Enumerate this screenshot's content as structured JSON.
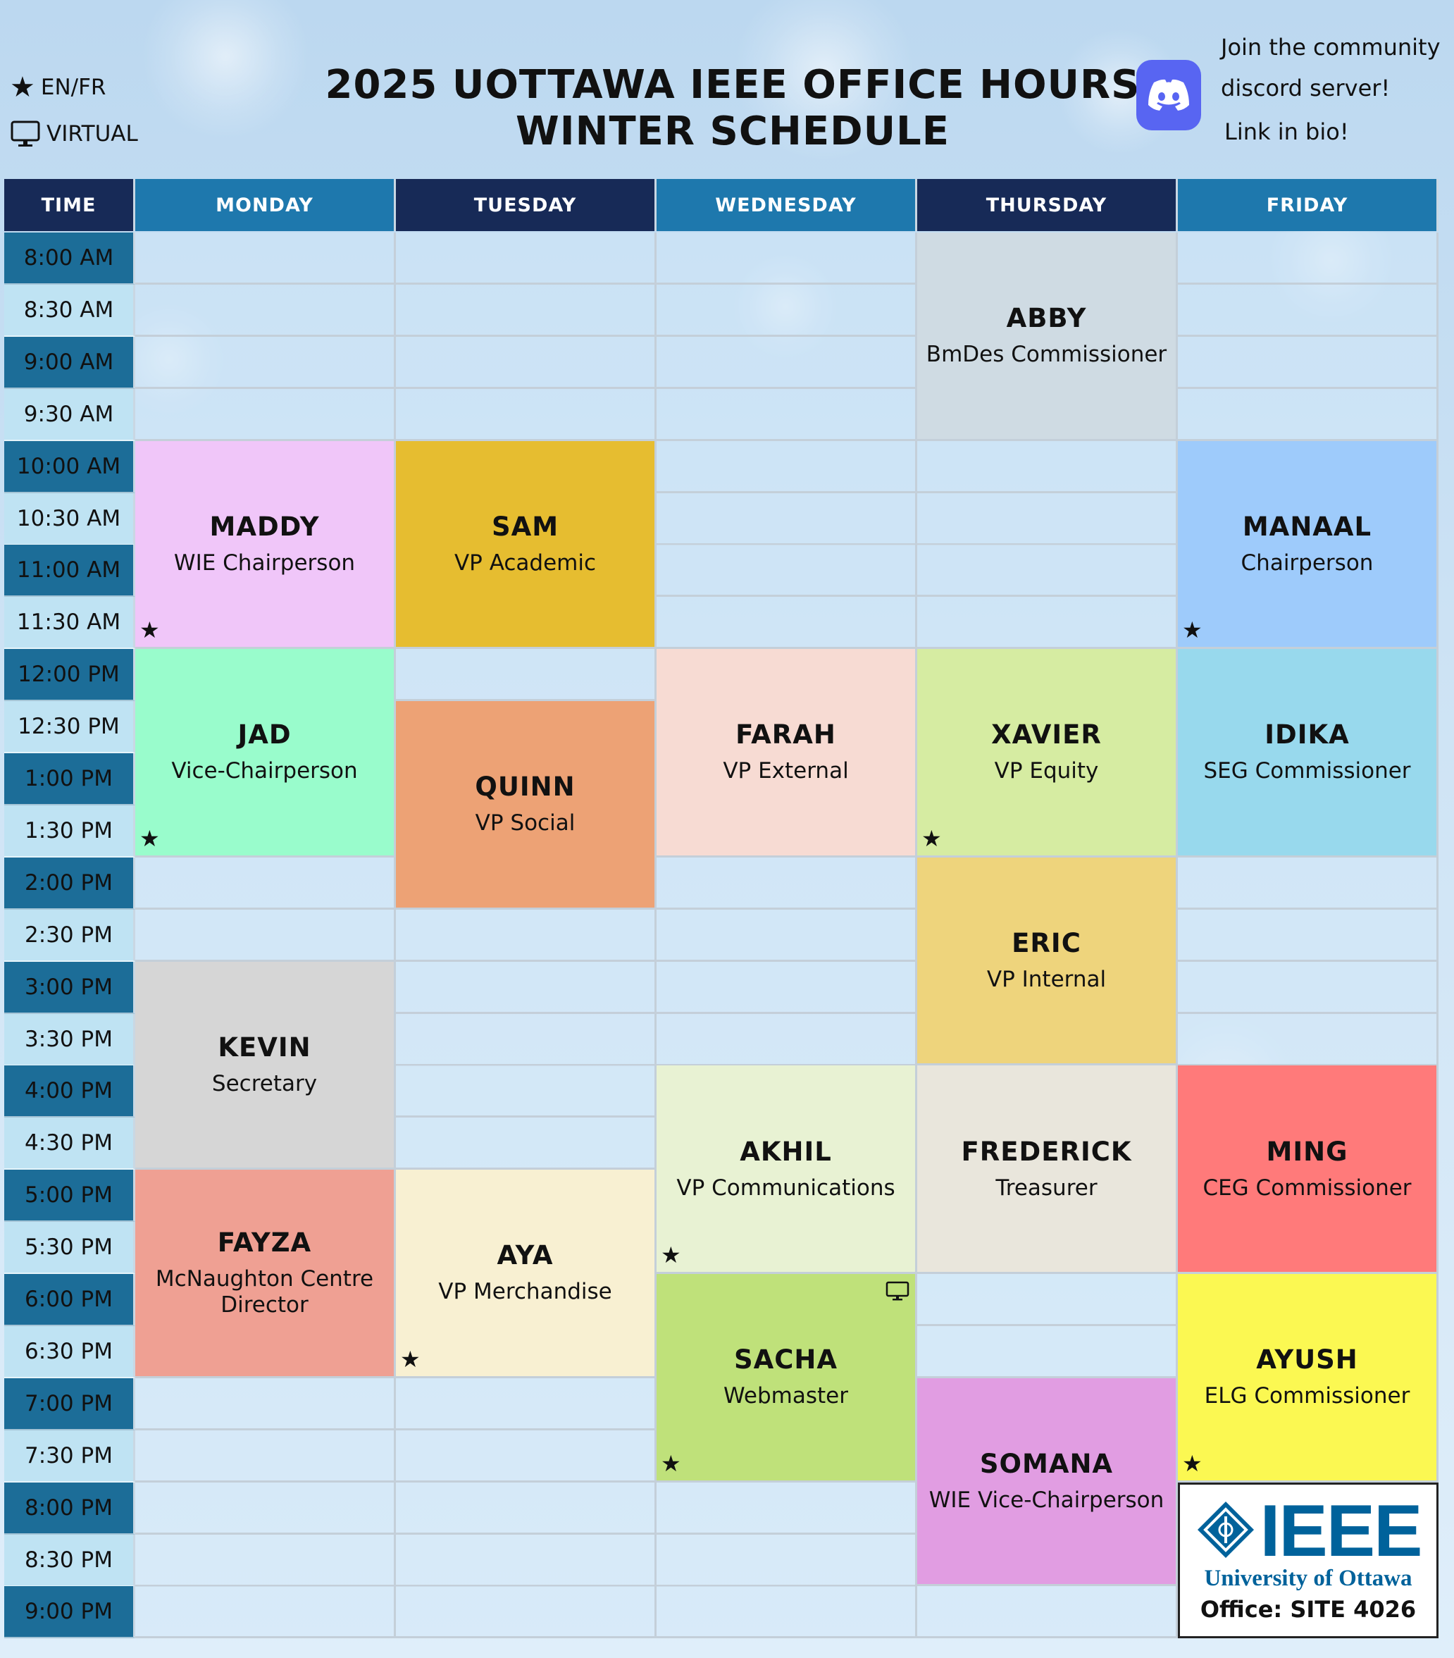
{
  "header": {
    "title_line1": "2025 UOTTAWA IEEE OFFICE HOURS",
    "title_line2": "WINTER SCHEDULE",
    "legend_bilingual": "EN/FR",
    "legend_virtual": "VIRTUAL",
    "discord_line1": "Join the community",
    "discord_line2": "discord server!",
    "discord_line3": "Link in bio!"
  },
  "columns": {
    "time": "TIME",
    "days": [
      "MONDAY",
      "TUESDAY",
      "WEDNESDAY",
      "THURSDAY",
      "FRIDAY"
    ]
  },
  "times": [
    "8:00 AM",
    "8:30 AM",
    "9:00 AM",
    "9:30 AM",
    "10:00 AM",
    "10:30 AM",
    "11:00 AM",
    "11:30 AM",
    "12:00 PM",
    "12:30 PM",
    "1:00 PM",
    "1:30 PM",
    "2:00 PM",
    "2:30 PM",
    "3:00 PM",
    "3:30 PM",
    "4:00 PM",
    "4:30 PM",
    "5:00 PM",
    "5:30 PM",
    "6:00 PM",
    "6:30 PM",
    "7:00 PM",
    "7:30 PM",
    "8:00 PM",
    "8:30 PM",
    "9:00 PM"
  ],
  "blocks": [
    {
      "name": "ABBY",
      "role": "BmDes Commissioner",
      "day": 3,
      "start": 0,
      "span": 4,
      "color": "#cfdbe3",
      "bilingual": false,
      "virtual": false
    },
    {
      "name": "MADDY",
      "role": "WIE Chairperson",
      "day": 0,
      "start": 4,
      "span": 4,
      "color": "#f0c6f9",
      "bilingual": true,
      "virtual": false
    },
    {
      "name": "SAM",
      "role": "VP Academic",
      "day": 1,
      "start": 4,
      "span": 4,
      "color": "#e6bd30",
      "bilingual": false,
      "virtual": false
    },
    {
      "name": "MANAAL",
      "role": "Chairperson",
      "day": 4,
      "start": 4,
      "span": 4,
      "color": "#9ecbfb",
      "bilingual": true,
      "virtual": false
    },
    {
      "name": "JAD",
      "role": "Vice-Chairperson",
      "day": 0,
      "start": 8,
      "span": 4,
      "color": "#99fccc",
      "bilingual": true,
      "virtual": false
    },
    {
      "name": "QUINN",
      "role": "VP Social",
      "day": 1,
      "start": 9,
      "span": 4,
      "color": "#eda275",
      "bilingual": false,
      "virtual": false
    },
    {
      "name": "FARAH",
      "role": "VP External",
      "day": 2,
      "start": 8,
      "span": 4,
      "color": "#f7dbd3",
      "bilingual": false,
      "virtual": false
    },
    {
      "name": "XAVIER",
      "role": "VP Equity",
      "day": 3,
      "start": 8,
      "span": 4,
      "color": "#d6eca2",
      "bilingual": true,
      "virtual": false
    },
    {
      "name": "IDIKA",
      "role": "SEG Commissioner",
      "day": 4,
      "start": 8,
      "span": 4,
      "color": "#98d9ed",
      "bilingual": false,
      "virtual": false
    },
    {
      "name": "ERIC",
      "role": "VP Internal",
      "day": 3,
      "start": 12,
      "span": 4,
      "color": "#eed47c",
      "bilingual": false,
      "virtual": false
    },
    {
      "name": "KEVIN",
      "role": "Secretary",
      "day": 0,
      "start": 14,
      "span": 4,
      "color": "#d6d6d6",
      "bilingual": false,
      "virtual": false
    },
    {
      "name": "AKHIL",
      "role": "VP Communications",
      "day": 2,
      "start": 16,
      "span": 4,
      "color": "#e8f2d3",
      "bilingual": true,
      "virtual": false
    },
    {
      "name": "FREDERICK",
      "role": "Treasurer",
      "day": 3,
      "start": 16,
      "span": 4,
      "color": "#e9e6dc",
      "bilingual": false,
      "virtual": false
    },
    {
      "name": "MING",
      "role": "CEG Commissioner",
      "day": 4,
      "start": 16,
      "span": 4,
      "color": "#ff7a7a",
      "bilingual": false,
      "virtual": false
    },
    {
      "name": "FAYZA",
      "role": "McNaughton Centre Director",
      "day": 0,
      "start": 18,
      "span": 4,
      "color": "#efa093",
      "bilingual": false,
      "virtual": false
    },
    {
      "name": "AYA",
      "role": "VP Merchandise",
      "day": 1,
      "start": 18,
      "span": 4,
      "color": "#f8f0d2",
      "bilingual": true,
      "virtual": false
    },
    {
      "name": "SACHA",
      "role": "Webmaster",
      "day": 2,
      "start": 20,
      "span": 4,
      "color": "#bfe17a",
      "bilingual": true,
      "virtual": true
    },
    {
      "name": "AYUSH",
      "role": "ELG Commissioner",
      "day": 4,
      "start": 20,
      "span": 4,
      "color": "#fbf852",
      "bilingual": true,
      "virtual": false
    },
    {
      "name": "SOMANA",
      "role": "WIE Vice-Chairperson",
      "day": 3,
      "start": 22,
      "span": 4,
      "color": "#e19de2",
      "bilingual": false,
      "virtual": false
    }
  ],
  "ieee_box": {
    "logo_text": "IEEE",
    "university": "University of Ottawa",
    "office": "Office: SITE 4026",
    "day": 4,
    "start": 24,
    "span": 3
  },
  "colors": {
    "header_dark": "#172a57",
    "header_blue": "#1e78ad",
    "time_dark": "#1c6d98",
    "time_light": "#bfe3f3",
    "ieee_blue": "#00629b",
    "discord": "#5865f2"
  },
  "icons": {
    "bilingual": "star-icon",
    "virtual": "monitor-icon",
    "discord": "discord-logo-icon"
  }
}
